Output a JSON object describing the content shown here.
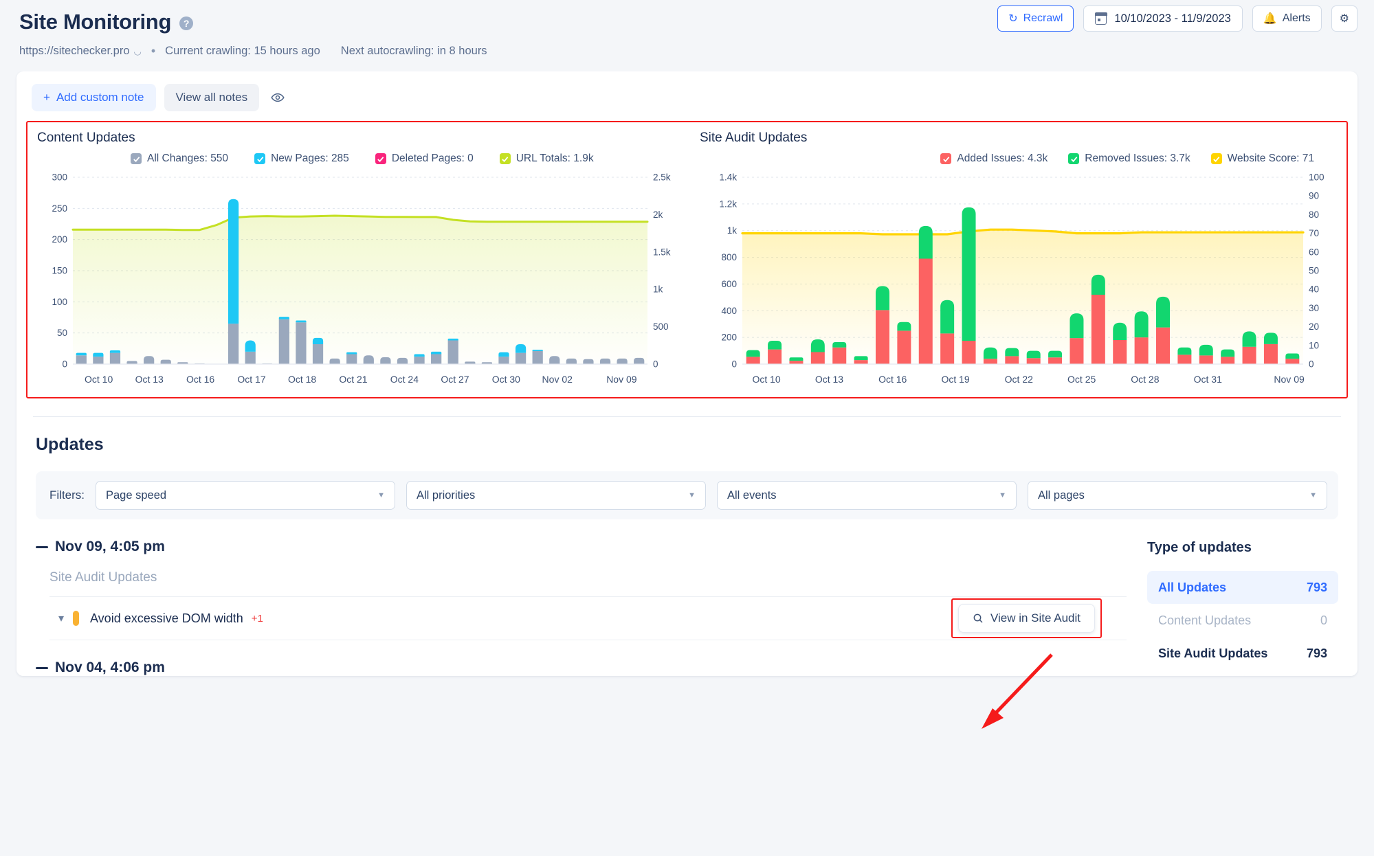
{
  "header": {
    "title": "Site Monitoring",
    "help_icon": "question-circle-icon",
    "url": "https://sitechecker.pro",
    "external_icon": "external-link-icon",
    "separator": "•",
    "current_crawling": "Current crawling: 15 hours ago",
    "next_autocrawling": "Next autocrawling: in 8 hours",
    "recrawl_label": "Recrawl",
    "recrawl_icon": "refresh-icon",
    "date_range": "10/10/2023 - 11/9/2023",
    "calendar_icon": "calendar-icon",
    "alerts_label": "Alerts",
    "alerts_icon": "bell-icon",
    "settings_icon": "gear-icon"
  },
  "notes_bar": {
    "add_note_label": "Add custom note",
    "plus_icon": "plus-icon",
    "view_all_label": "View all notes",
    "eye_icon": "eye-icon"
  },
  "chart_data": [
    {
      "type": "bar",
      "title": "Content Updates",
      "legend": [
        {
          "label": "All Changes: 550",
          "color": "#9aa8bd",
          "checked": true
        },
        {
          "label": "New Pages: 285",
          "color": "#1ec8f5",
          "checked": true
        },
        {
          "label": "Deleted Pages: 0",
          "color": "#f9247c",
          "checked": true
        },
        {
          "label": "URL Totals: 1.9k",
          "color": "#c4e023",
          "checked": true
        }
      ],
      "ylim": [
        0,
        300
      ],
      "yticks": [
        "0",
        "50",
        "100",
        "150",
        "200",
        "250",
        "300"
      ],
      "y2lim": [
        0,
        2500
      ],
      "y2ticks": [
        "0",
        "500",
        "1k",
        "1.5k",
        "2k",
        "2.5k"
      ],
      "xlabels": [
        "Oct 10",
        "Oct 13",
        "Oct 16",
        "Oct 17",
        "Oct 18",
        "Oct 21",
        "Oct 24",
        "Oct 27",
        "Oct 30",
        "Nov 02",
        "Nov 09"
      ],
      "xlabel_positions": [
        0.045,
        0.133,
        0.222,
        0.311,
        0.399,
        0.488,
        0.577,
        0.665,
        0.754,
        0.843,
        0.955
      ],
      "grid": true,
      "series": [
        {
          "name": "All Changes",
          "color": "#9aa8bd",
          "values": [
            14,
            12,
            18,
            5,
            13,
            7,
            3,
            1,
            0,
            65,
            20,
            1,
            72,
            67,
            32,
            9,
            16,
            14,
            11,
            10,
            12,
            16,
            38,
            4,
            3,
            12,
            18,
            21,
            13,
            9,
            8,
            9,
            9,
            10
          ]
        },
        {
          "name": "New Pages",
          "color": "#1ec8f5",
          "values": [
            4,
            6,
            4,
            0,
            0,
            0,
            0,
            0,
            0,
            200,
            18,
            0,
            4,
            3,
            10,
            0,
            3,
            0,
            0,
            0,
            4,
            4,
            3,
            0,
            0,
            7,
            14,
            2,
            0,
            0,
            0,
            0,
            0,
            0
          ]
        },
        {
          "name": "Deleted Pages",
          "color": "#f9247c",
          "values": [
            0,
            0,
            0,
            0,
            0,
            0,
            0,
            0,
            0,
            0,
            0,
            0,
            0,
            0,
            0,
            0,
            0,
            0,
            0,
            0,
            0,
            0,
            0,
            0,
            0,
            0,
            0,
            0,
            0,
            0,
            0,
            0,
            0,
            0
          ]
        },
        {
          "name": "URL Totals",
          "color": "#c4e023",
          "axis": "right",
          "values": [
            1800,
            1800,
            1800,
            1800,
            1800,
            1800,
            1795,
            1795,
            1860,
            1960,
            1975,
            1980,
            1975,
            1975,
            1980,
            1985,
            1980,
            1975,
            1970,
            1970,
            1968,
            1968,
            1930,
            1910,
            1905,
            1905,
            1905,
            1905,
            1905,
            1905,
            1905,
            1905,
            1905,
            1905
          ]
        }
      ]
    },
    {
      "type": "bar",
      "title": "Site Audit Updates",
      "legend": [
        {
          "label": "Added Issues: 4.3k",
          "color": "#fc6262",
          "checked": true
        },
        {
          "label": "Removed Issues: 3.7k",
          "color": "#12d66f",
          "checked": true
        },
        {
          "label": "Website Score: 71",
          "color": "#ffd400",
          "checked": true
        }
      ],
      "ylim": [
        0,
        1400
      ],
      "yticks": [
        "0",
        "200",
        "400",
        "600",
        "800",
        "1k",
        "1.2k",
        "1.4k"
      ],
      "y2lim": [
        0,
        100
      ],
      "y2ticks": [
        "0",
        "10",
        "20",
        "30",
        "40",
        "50",
        "60",
        "70",
        "80",
        "90",
        "100"
      ],
      "xlabels": [
        "Oct 10",
        "Oct 13",
        "Oct 16",
        "Oct 19",
        "Oct 22",
        "Oct 25",
        "Oct 28",
        "Oct 31",
        "Nov 09"
      ],
      "xlabel_positions": [
        0.043,
        0.155,
        0.268,
        0.38,
        0.493,
        0.605,
        0.718,
        0.83,
        0.975
      ],
      "grid": true,
      "series": [
        {
          "name": "Added Issues",
          "color": "#fc6262",
          "values": [
            55,
            110,
            25,
            90,
            125,
            30,
            405,
            250,
            790,
            230,
            175,
            40,
            60,
            45,
            50,
            195,
            520,
            180,
            200,
            275,
            70,
            65,
            55,
            130,
            150,
            40
          ]
        },
        {
          "name": "Removed Issues",
          "color": "#12d66f",
          "values": [
            50,
            65,
            25,
            95,
            40,
            30,
            180,
            65,
            245,
            250,
            1000,
            85,
            60,
            55,
            50,
            185,
            150,
            130,
            195,
            230,
            55,
            80,
            55,
            115,
            85,
            40
          ]
        },
        {
          "name": "Website Score",
          "color": "#ffd400",
          "axis": "right",
          "values": [
            70,
            70,
            70,
            70,
            70,
            70,
            69.5,
            69.5,
            69.5,
            69.5,
            71,
            72,
            72,
            71.5,
            71,
            70,
            70,
            70,
            70.5,
            70.5,
            70.5,
            70.5,
            70.5,
            70.5,
            70.5,
            70.5
          ]
        }
      ]
    }
  ],
  "updates": {
    "section_title": "Updates",
    "filters_label": "Filters:",
    "filters": [
      {
        "name": "page-speed",
        "value": "Page speed"
      },
      {
        "name": "all-priorities",
        "value": "All priorities"
      },
      {
        "name": "all-events",
        "value": "All events"
      },
      {
        "name": "all-pages",
        "value": "All pages"
      }
    ],
    "groups": [
      {
        "date": "Nov 09, 4:05 pm",
        "subtitle": "Site Audit Updates",
        "rows": [
          {
            "name": "Avoid excessive DOM width",
            "delta": "+1",
            "priority_color": "#f9b233"
          }
        ],
        "view_button": "View in Site Audit",
        "search_icon": "search-icon"
      },
      {
        "date": "Nov 04, 4:06 pm"
      }
    ]
  },
  "type_of_updates": {
    "title": "Type of updates",
    "rows": [
      {
        "label": "All Updates",
        "count": "793",
        "state": "active"
      },
      {
        "label": "Content Updates",
        "count": "0",
        "state": "muted"
      },
      {
        "label": "Site Audit Updates",
        "count": "793",
        "state": "normal"
      }
    ]
  }
}
